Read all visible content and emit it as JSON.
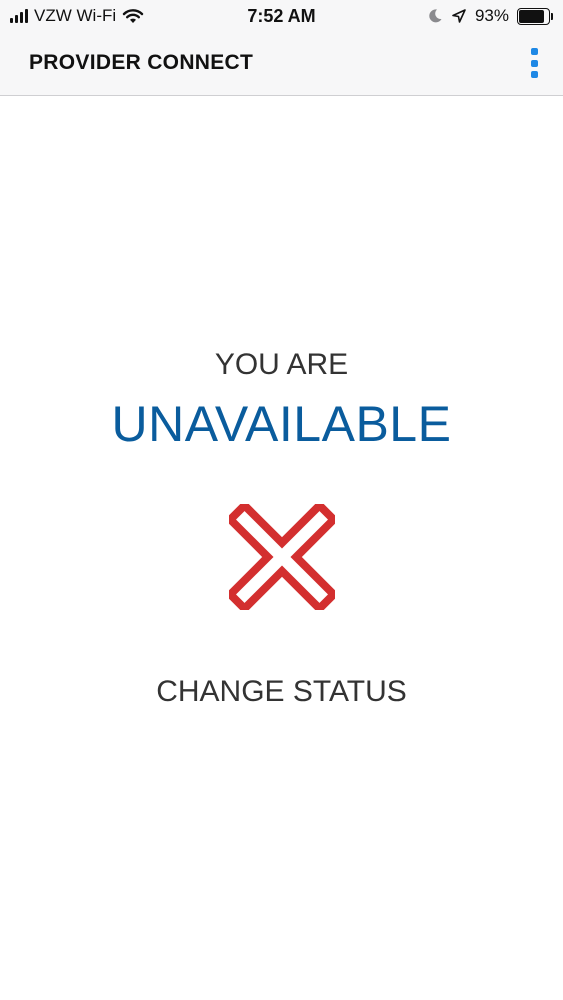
{
  "status_bar": {
    "carrier": "VZW Wi-Fi",
    "time": "7:52 AM",
    "battery_percent": "93%",
    "battery_level": 0.93,
    "icons": [
      "signal-icon",
      "wifi-icon",
      "moon-icon",
      "location-arrow-icon",
      "battery-icon"
    ]
  },
  "header": {
    "title": "PROVIDER CONNECT",
    "menu_icon": "kebab-menu-icon",
    "menu_color": "#1e88e5"
  },
  "main": {
    "prefix": "YOU ARE",
    "status": "UNAVAILABLE",
    "status_color": "#0a5c9d",
    "status_icon": "x-icon",
    "status_icon_color": "#d32f2f",
    "change_status_label": "CHANGE STATUS"
  }
}
